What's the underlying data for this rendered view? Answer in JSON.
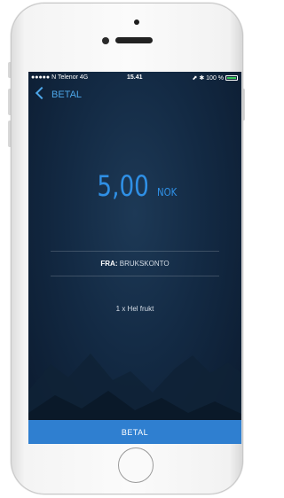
{
  "status_bar": {
    "carrier": "●●●●● N Telenor  4G",
    "time": "15.41",
    "battery": "⬈ ✱ 100 %"
  },
  "nav": {
    "back_label": "BETAL",
    "back_icon": "chevron-left-icon"
  },
  "payment": {
    "amount": "5,00",
    "currency": "NOK",
    "from_label": "FRA:",
    "from_account": "BRUKSKONTO",
    "item": "1 x Hel frukt"
  },
  "pay_button": {
    "label": "BETAL"
  },
  "colors": {
    "accent": "#2f90e6",
    "pay_button": "#2f7fd0",
    "background": "#132a44"
  }
}
